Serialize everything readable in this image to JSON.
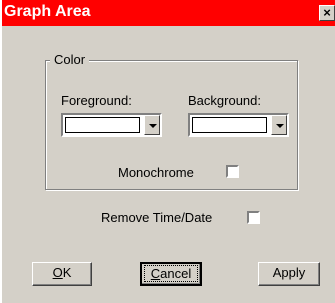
{
  "window": {
    "title": "Graph Area",
    "close_glyph": "×"
  },
  "color_group": {
    "legend": "Color",
    "foreground_label": "Foreground:",
    "background_label": "Background:",
    "foreground_value": "",
    "background_value": "",
    "monochrome_label": "Monochrome",
    "monochrome_checked": false
  },
  "options": {
    "remove_time_date_label": "Remove Time/Date",
    "remove_time_date_checked": false
  },
  "buttons": {
    "ok_mnemonic": "O",
    "ok_rest": "K",
    "cancel_mnemonic": "C",
    "cancel_rest": "ancel",
    "apply": "Apply"
  }
}
